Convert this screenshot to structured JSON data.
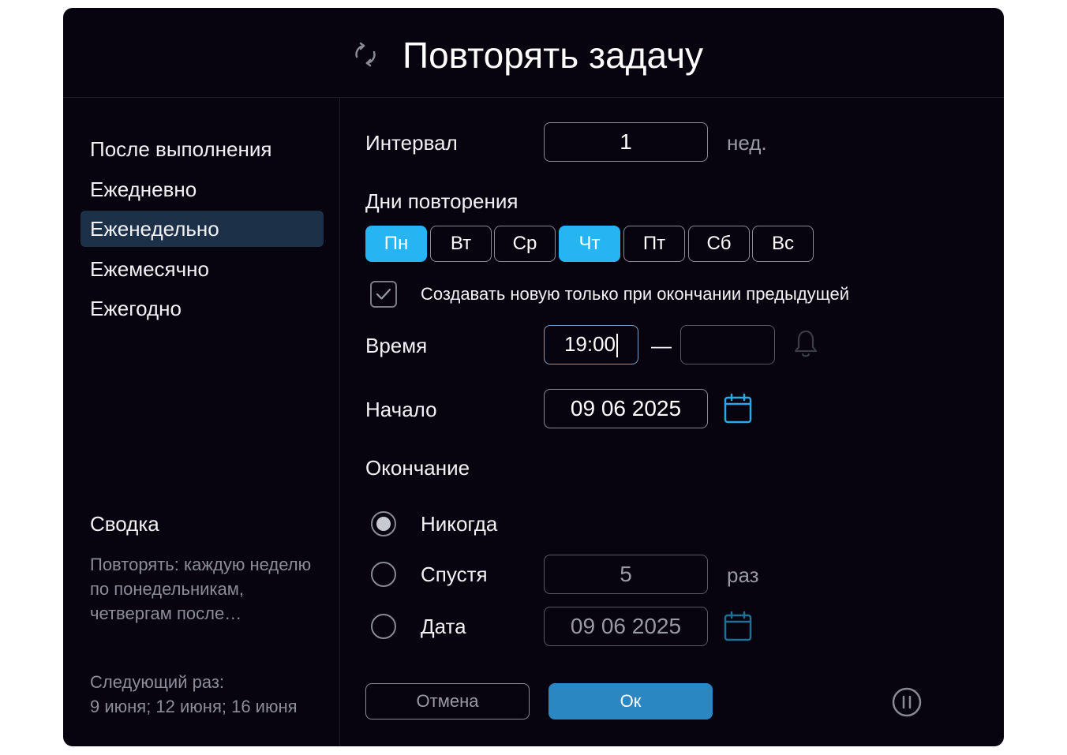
{
  "dialog": {
    "title": "Повторять задачу",
    "icons": {
      "header": "repeat-icon",
      "calendar": "calendar-icon",
      "bell": "bell-icon",
      "pause": "pause-icon",
      "check": "check-icon"
    },
    "colors": {
      "background": "#07040f",
      "accent": "#27b4f3",
      "ok_button": "#2a87c2",
      "selected_nav": "#1c3048",
      "calendar_icon": "#2aa8e8"
    }
  },
  "sidebar": {
    "items": [
      {
        "label": "После выполнения",
        "selected": false
      },
      {
        "label": "Ежедневно",
        "selected": false
      },
      {
        "label": "Еженедельно",
        "selected": true
      },
      {
        "label": "Ежемесячно",
        "selected": false
      },
      {
        "label": "Ежегодно",
        "selected": false
      }
    ],
    "summary_title": "Сводка",
    "summary_text": "Повторять: каждую неделю по понедельникам, четвергам после…",
    "next_label": "Следующий раз:",
    "next_dates": "9 июня; 12 июня; 16 июня"
  },
  "form": {
    "interval_label": "Интервал",
    "interval_value": "1",
    "interval_unit": "нед.",
    "days_label": "Дни повторения",
    "days": [
      {
        "label": "Пн",
        "on": true
      },
      {
        "label": "Вт",
        "on": false
      },
      {
        "label": "Ср",
        "on": false
      },
      {
        "label": "Чт",
        "on": true
      },
      {
        "label": "Пт",
        "on": false
      },
      {
        "label": "Сб",
        "on": false
      },
      {
        "label": "Вс",
        "on": false
      }
    ],
    "create_only_after_label": "Создавать новую только при окончании предыдущей",
    "create_only_after_checked": true,
    "time_label": "Время",
    "time_start": "19:00",
    "time_separator": "—",
    "time_end": "",
    "start_label": "Начало",
    "start_date": "09 06 2025",
    "end_label": "Окончание",
    "end_options": {
      "never_label": "Никогда",
      "after_label": "Спустя",
      "after_value": "5",
      "after_unit": "раз",
      "date_label": "Дата",
      "date_value": "09 06 2025",
      "selected": "never"
    }
  },
  "buttons": {
    "cancel": "Отмена",
    "ok": "Ок"
  }
}
